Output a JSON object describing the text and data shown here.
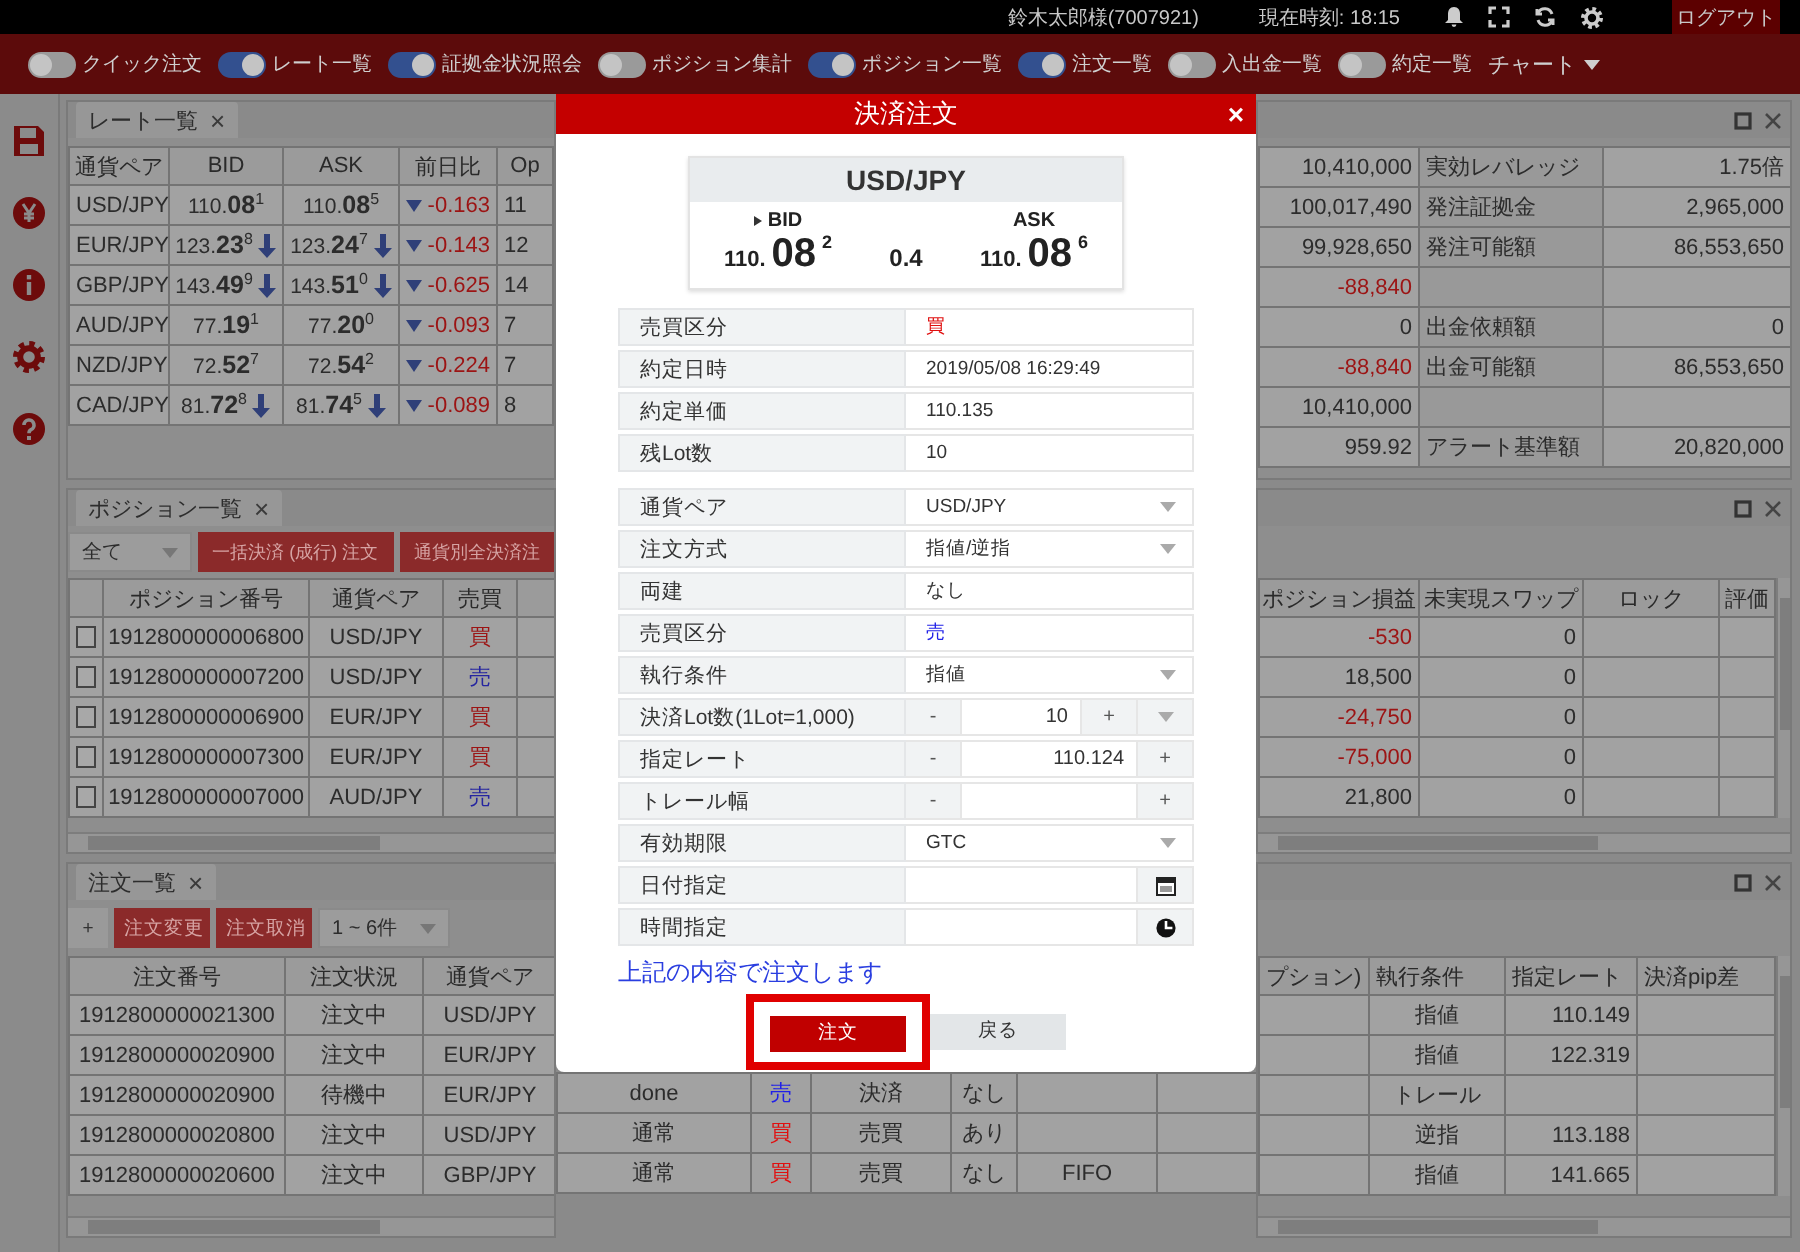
{
  "top_bar": {
    "user": "鈴木太郎様(7007921)",
    "clock": "現在時刻: 18:15",
    "logout": "ログアウト"
  },
  "toggles": [
    {
      "label": "クイック注文",
      "on": false
    },
    {
      "label": "レート一覧",
      "on": true
    },
    {
      "label": "証拠金状況照会",
      "on": true
    },
    {
      "label": "ポジション集計",
      "on": false
    },
    {
      "label": "ポジション一覧",
      "on": true
    },
    {
      "label": "注文一覧",
      "on": true
    },
    {
      "label": "入出金一覧",
      "on": false
    },
    {
      "label": "約定一覧",
      "on": false
    }
  ],
  "chart_menu": {
    "label": "チャート"
  },
  "rate_panel": {
    "title": "レート一覧",
    "close": "×",
    "columns": [
      "通貨ペア",
      "BID",
      "ASK",
      "前日比",
      "Op"
    ],
    "rows": [
      {
        "pair": "USD/JPY",
        "bid": "110.**08**$^{1}$",
        "bid_falling": false,
        "ask": "110.**08**$^{5}$",
        "ask_falling": false,
        "falling": true,
        "change": "-0.163",
        "op": "11"
      },
      {
        "pair": "EUR/JPY",
        "bid": "123.**23**$^{8}$",
        "bid_falling": true,
        "ask": "123.**24**$^{7}$",
        "ask_falling": true,
        "falling": true,
        "change": "-0.143",
        "op": "12"
      },
      {
        "pair": "GBP/JPY",
        "bid": "143.**49**$^{9}$",
        "bid_falling": true,
        "ask": "143.**51**$^{0}$",
        "ask_falling": true,
        "falling": true,
        "change": "-0.625",
        "op": "14"
      },
      {
        "pair": "AUD/JPY",
        "bid": "77.**19**$^{1}$",
        "bid_falling": false,
        "ask": "77.**20**$^{0}$",
        "ask_falling": false,
        "falling": true,
        "change": "-0.093",
        "op": "7"
      },
      {
        "pair": "NZD/JPY",
        "bid": "72.**52**$^{7}$",
        "bid_falling": false,
        "ask": "72.**54**$^{2}$",
        "ask_falling": false,
        "falling": true,
        "change": "-0.224",
        "op": "7"
      },
      {
        "pair": "CAD/JPY",
        "bid": "81.**72**$^{8}$",
        "bid_falling": true,
        "ask": "81.**74**$^{5}$",
        "ask_falling": true,
        "falling": true,
        "change": "-0.089",
        "op": "8"
      }
    ]
  },
  "margin_panel": {
    "column_1": [
      {
        "value": "10,410,000",
        "negative": false
      },
      {
        "value": "100,017,490",
        "negative": false
      },
      {
        "value": "99,928,650",
        "negative": false
      },
      {
        "value": "-88,840",
        "negative": true
      },
      {
        "value": "0",
        "negative": false
      },
      {
        "value": "-88,840",
        "negative": true
      },
      {
        "value": "10,410,000",
        "negative": false
      },
      {
        "value": "959.92",
        "negative": false
      }
    ],
    "items": [
      {
        "kind": "item",
        "label": "実効レバレッジ",
        "amount": "1.75倍"
      },
      {
        "kind": "item",
        "label": "発注証拠金",
        "amount": "2,965,000"
      },
      {
        "kind": "item",
        "label": "発注可能額",
        "amount": "86,553,650"
      },
      {
        "kind": "blank"
      },
      {
        "kind": "item",
        "label": "出金依頼額",
        "amount": "0"
      },
      {
        "kind": "item",
        "label": "出金可能額",
        "amount": "86,553,650"
      },
      {
        "kind": "blank"
      },
      {
        "kind": "item",
        "label": "アラート基準額",
        "amount": "20,820,000"
      }
    ]
  },
  "position_panel": {
    "title": "ポジション一覧",
    "close": "×",
    "filter": "全て",
    "buttons": [
      "一括決済 (成行) 注文",
      "通貨別全決済注"
    ],
    "columns": [
      "ポジション番号",
      "通貨ペア",
      "売買",
      "ポジション損益",
      "未実現スワップ",
      "ロック",
      "評価"
    ],
    "rows": [
      {
        "checked": false,
        "number": "1912800000006800",
        "pair": "USD/JPY",
        "buy": true,
        "side_label": "買",
        "pl": "-530",
        "negative": true,
        "swap": "0"
      },
      {
        "checked": false,
        "number": "1912800000007200",
        "pair": "USD/JPY",
        "buy": false,
        "side_label": "売",
        "pl": "18,500",
        "negative": false,
        "swap": "0"
      },
      {
        "checked": false,
        "number": "1912800000006900",
        "pair": "EUR/JPY",
        "buy": true,
        "side_label": "買",
        "pl": "-24,750",
        "negative": true,
        "swap": "0"
      },
      {
        "checked": false,
        "number": "1912800000007300",
        "pair": "EUR/JPY",
        "buy": true,
        "side_label": "買",
        "pl": "-75,000",
        "negative": true,
        "swap": "0"
      },
      {
        "checked": false,
        "number": "1912800000007000",
        "pair": "AUD/JPY",
        "buy": false,
        "side_label": "売",
        "pl": "21,800",
        "negative": false,
        "swap": "0"
      }
    ]
  },
  "order_panel": {
    "title": "注文一覧",
    "close": "×",
    "add": "+",
    "buttons": [
      "注文変更",
      "注文取消"
    ],
    "range": "1 ~ 6件",
    "columns": [
      "注文番号",
      "注文状況",
      "通貨ペア",
      "プション)",
      "執行条件",
      "指定レート",
      "決済pip差"
    ],
    "rows": [
      {
        "number": "1912800000021300",
        "status": "注文中",
        "pair": "USD/JPY",
        "exec": "指値",
        "rate": "110.149"
      },
      {
        "number": "1912800000020900",
        "status": "注文中",
        "pair": "EUR/JPY",
        "exec": "指値",
        "rate": "122.319"
      },
      {
        "number": "1912800000020900",
        "status": "待機中",
        "pair": "EUR/JPY",
        "type": "done",
        "buy": false,
        "side_label": "売",
        "trade": "決済",
        "hedge": "なし",
        "exec": "トレール"
      },
      {
        "number": "1912800000020800",
        "status": "注文中",
        "pair": "USD/JPY",
        "type": "通常",
        "buy": true,
        "side_label": "買",
        "trade": "売買",
        "hedge": "あり",
        "exec": "逆指",
        "rate": "113.188"
      },
      {
        "number": "1912800000020600",
        "status": "注文中",
        "pair": "GBP/JPY",
        "type": "通常",
        "buy": true,
        "side_label": "買",
        "trade": "売買",
        "hedge": "なし",
        "fifo": "FIFO",
        "exec": "指値",
        "rate": "141.665"
      }
    ]
  },
  "order_dialog": {
    "title": "決済注文",
    "close": "×",
    "quote": {
      "pair": "USD/JPY",
      "bid_label": "BID",
      "bid": {
        "head": "110.",
        "big": "08",
        "pip": "2"
      },
      "spread": "0.4",
      "ask_label": "ASK",
      "ask": {
        "head": "110.",
        "big": "08",
        "pip": "6"
      }
    },
    "fill_details": [
      {
        "kind": "side",
        "label": "売買区分",
        "value": "買",
        "buy": true
      },
      {
        "kind": "text",
        "label": "約定日時",
        "value": "2019/05/08 16:29:49"
      },
      {
        "kind": "text",
        "label": "約定単価",
        "value": "110.135"
      },
      {
        "kind": "text",
        "label": "残Lot数",
        "value": "10"
      }
    ],
    "fields": [
      {
        "kind": "select",
        "label": "通貨ペア",
        "value": "USD/JPY"
      },
      {
        "kind": "select",
        "label": "注文方式",
        "value": "指値/逆指"
      },
      {
        "kind": "text",
        "label": "両建",
        "value": "なし"
      },
      {
        "kind": "side",
        "label": "売買区分",
        "value": "売",
        "buy": false
      },
      {
        "kind": "select",
        "label": "執行条件",
        "value": "指値"
      },
      {
        "kind": "stepper",
        "label": "決済Lot数(1Lot=1,000)",
        "minus": "-",
        "value": "10",
        "plus": "+",
        "dropdown": true
      },
      {
        "kind": "stepper",
        "label": "指定レート",
        "minus": "-",
        "value": "110.124",
        "plus": "+",
        "dropdown": false
      },
      {
        "kind": "stepper",
        "label": "トレール幅",
        "minus": "-",
        "plus": "+",
        "dropdown": false
      },
      {
        "kind": "select",
        "label": "有効期限",
        "value": "GTC"
      },
      {
        "kind": "date",
        "label": "日付指定"
      },
      {
        "kind": "time",
        "label": "時間指定"
      }
    ],
    "notice": "上記の内容で注文します",
    "submit": {
      "label": "注文",
      "highlighted": true
    },
    "back": "戻る"
  }
}
